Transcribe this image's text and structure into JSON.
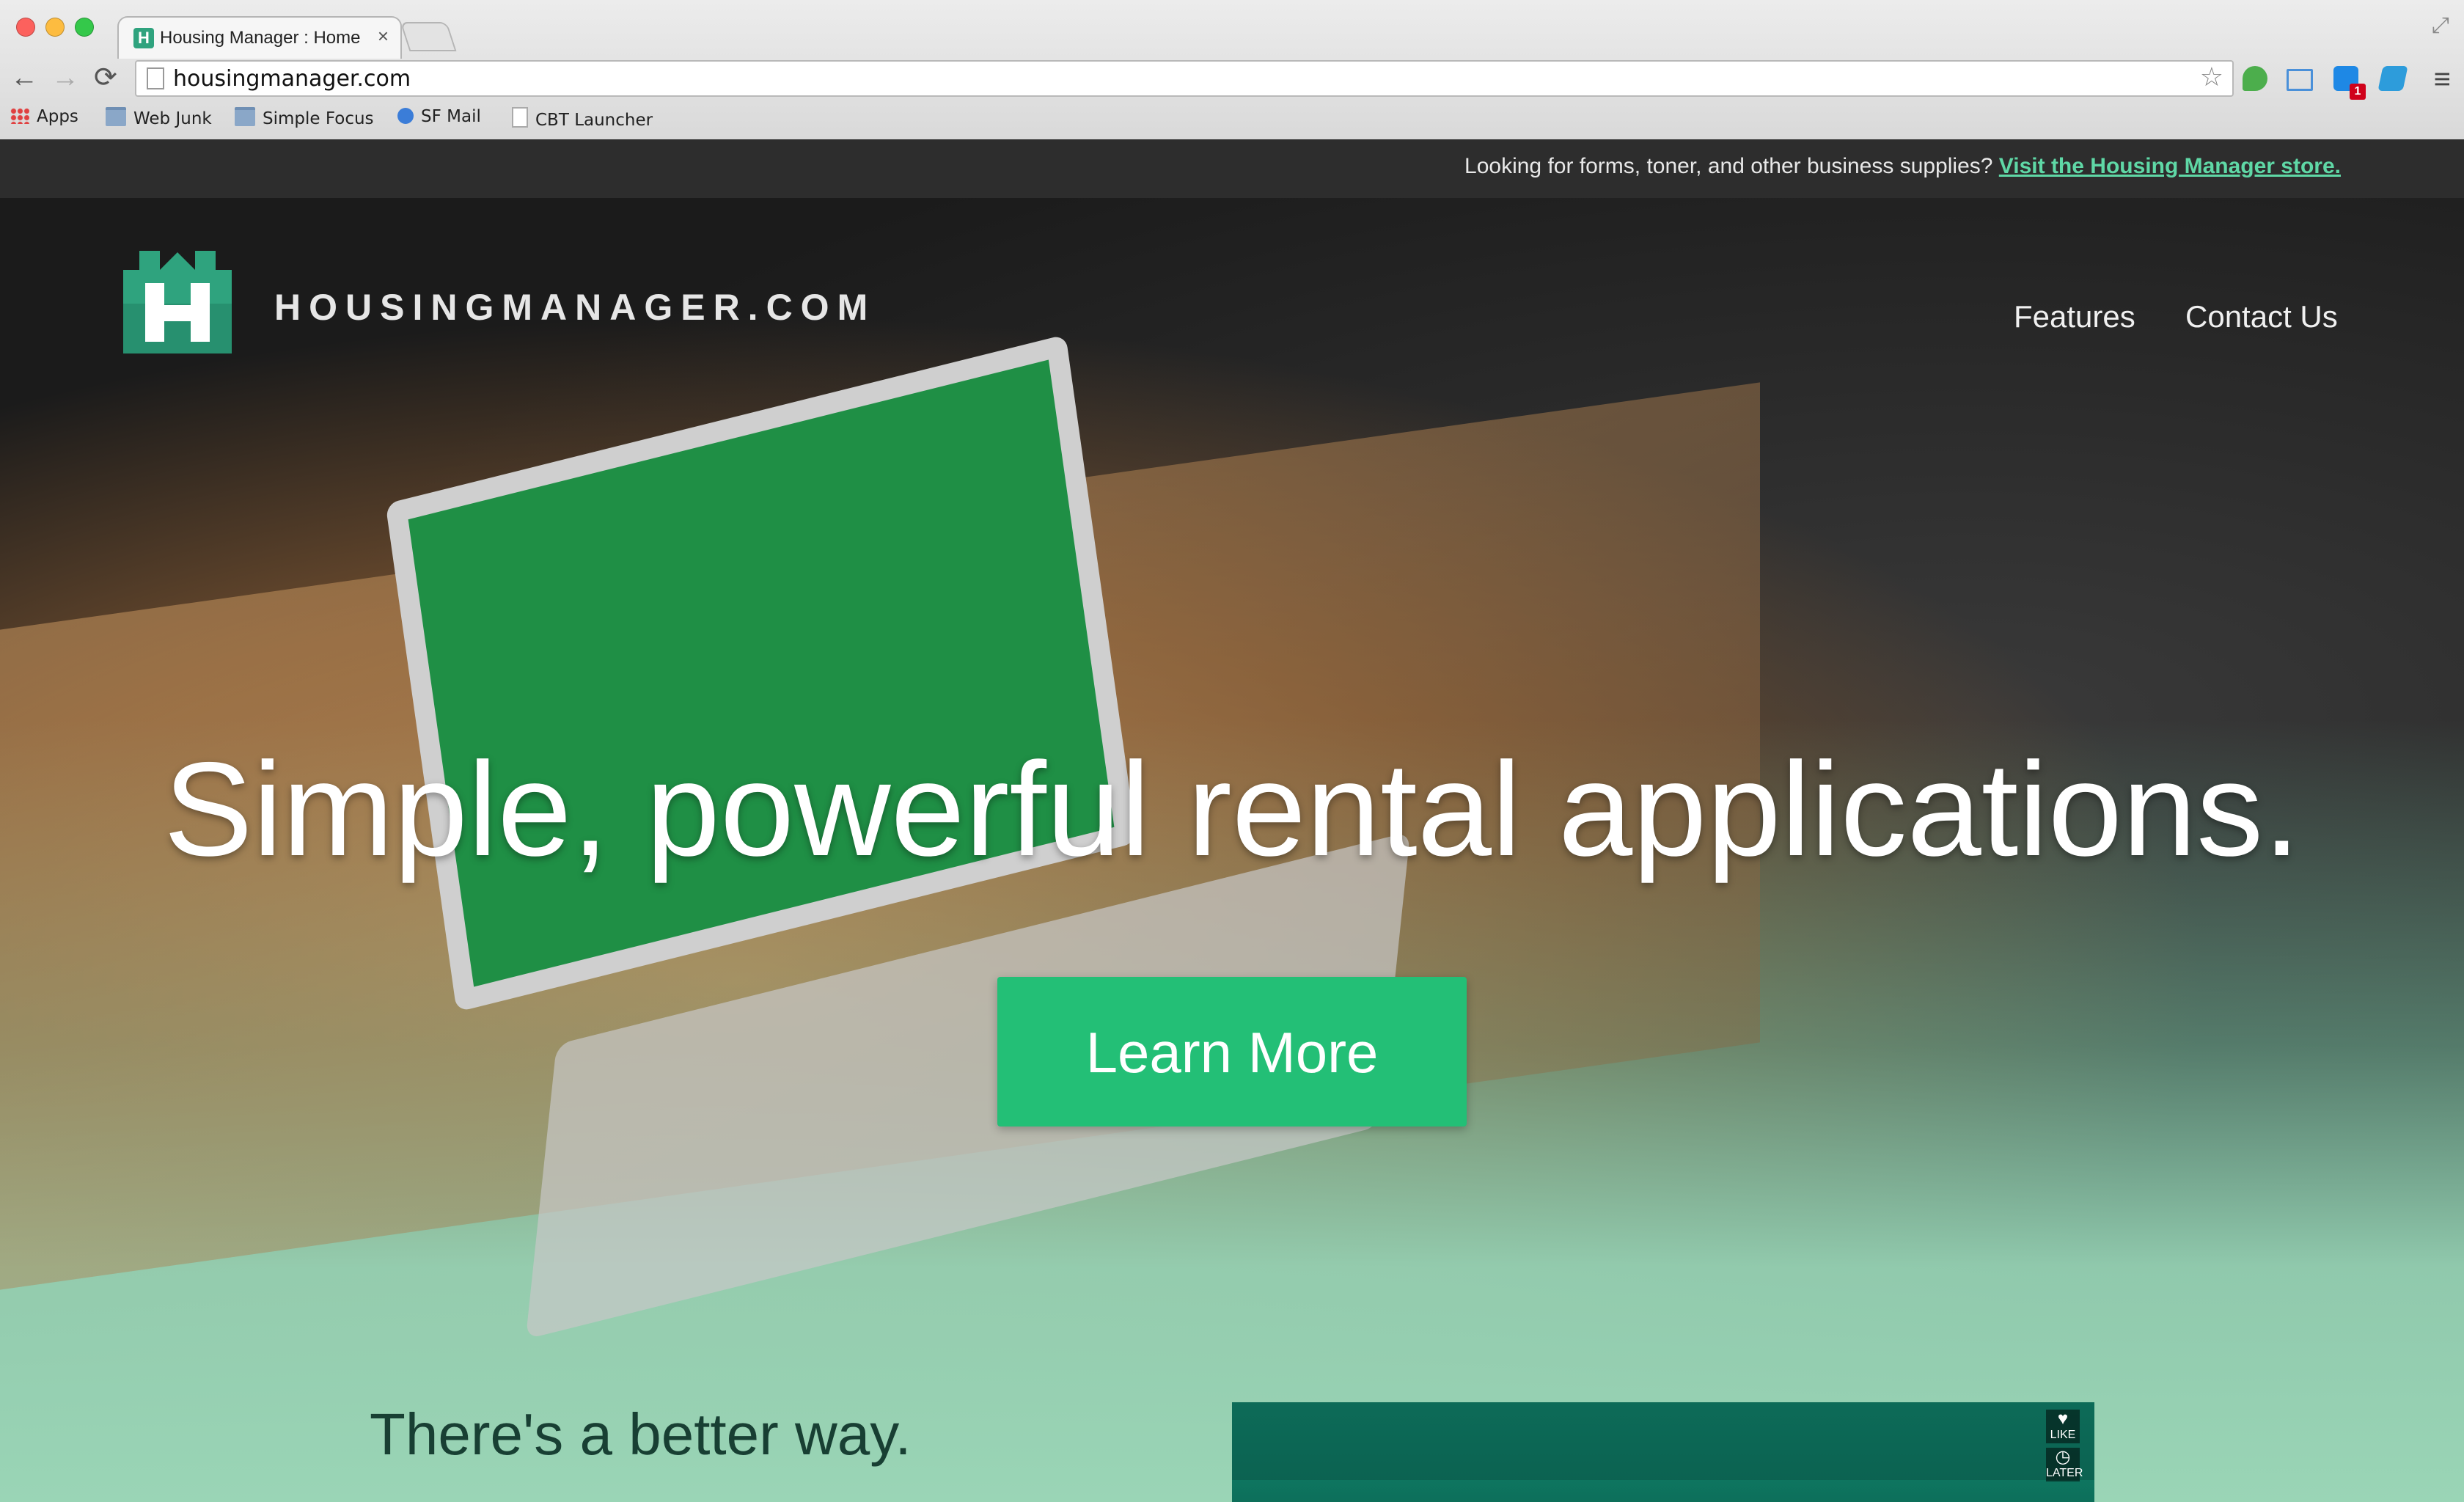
{
  "browser": {
    "tab_title": "Housing Manager : Home",
    "tab_close": "×",
    "url": "housingmanager.com",
    "bookmarks": [
      "Apps",
      "Web Junk",
      "Simple Focus",
      "SF Mail",
      "CBT Launcher"
    ],
    "ext_badge": "1",
    "icons": {
      "back": "←",
      "forward": "→",
      "reload": "⟳",
      "star": "☆",
      "menu": "≡",
      "fullscreen": "⤢"
    }
  },
  "promo": {
    "text": "Looking for forms, toner, and other business supplies?",
    "link": "Visit the Housing Manager store."
  },
  "header": {
    "brand": "HOUSINGMANAGER.COM",
    "nav": [
      "Features",
      "Contact Us"
    ]
  },
  "hero": {
    "headline": "Simple, powerful rental applications.",
    "cta": "Learn More"
  },
  "section": {
    "subhead": "There's a better way."
  },
  "video": {
    "buttons": [
      {
        "icon": "heart-icon",
        "label": "LIKE"
      },
      {
        "icon": "clock-icon",
        "label": "LATER"
      }
    ]
  },
  "colors": {
    "brand_green": "#23bf76",
    "logo_teal": "#2fa37e",
    "promo_link": "#5fd8a6",
    "promo_bar": "#2d2d2d",
    "section_bg": "#9ad5b6"
  }
}
